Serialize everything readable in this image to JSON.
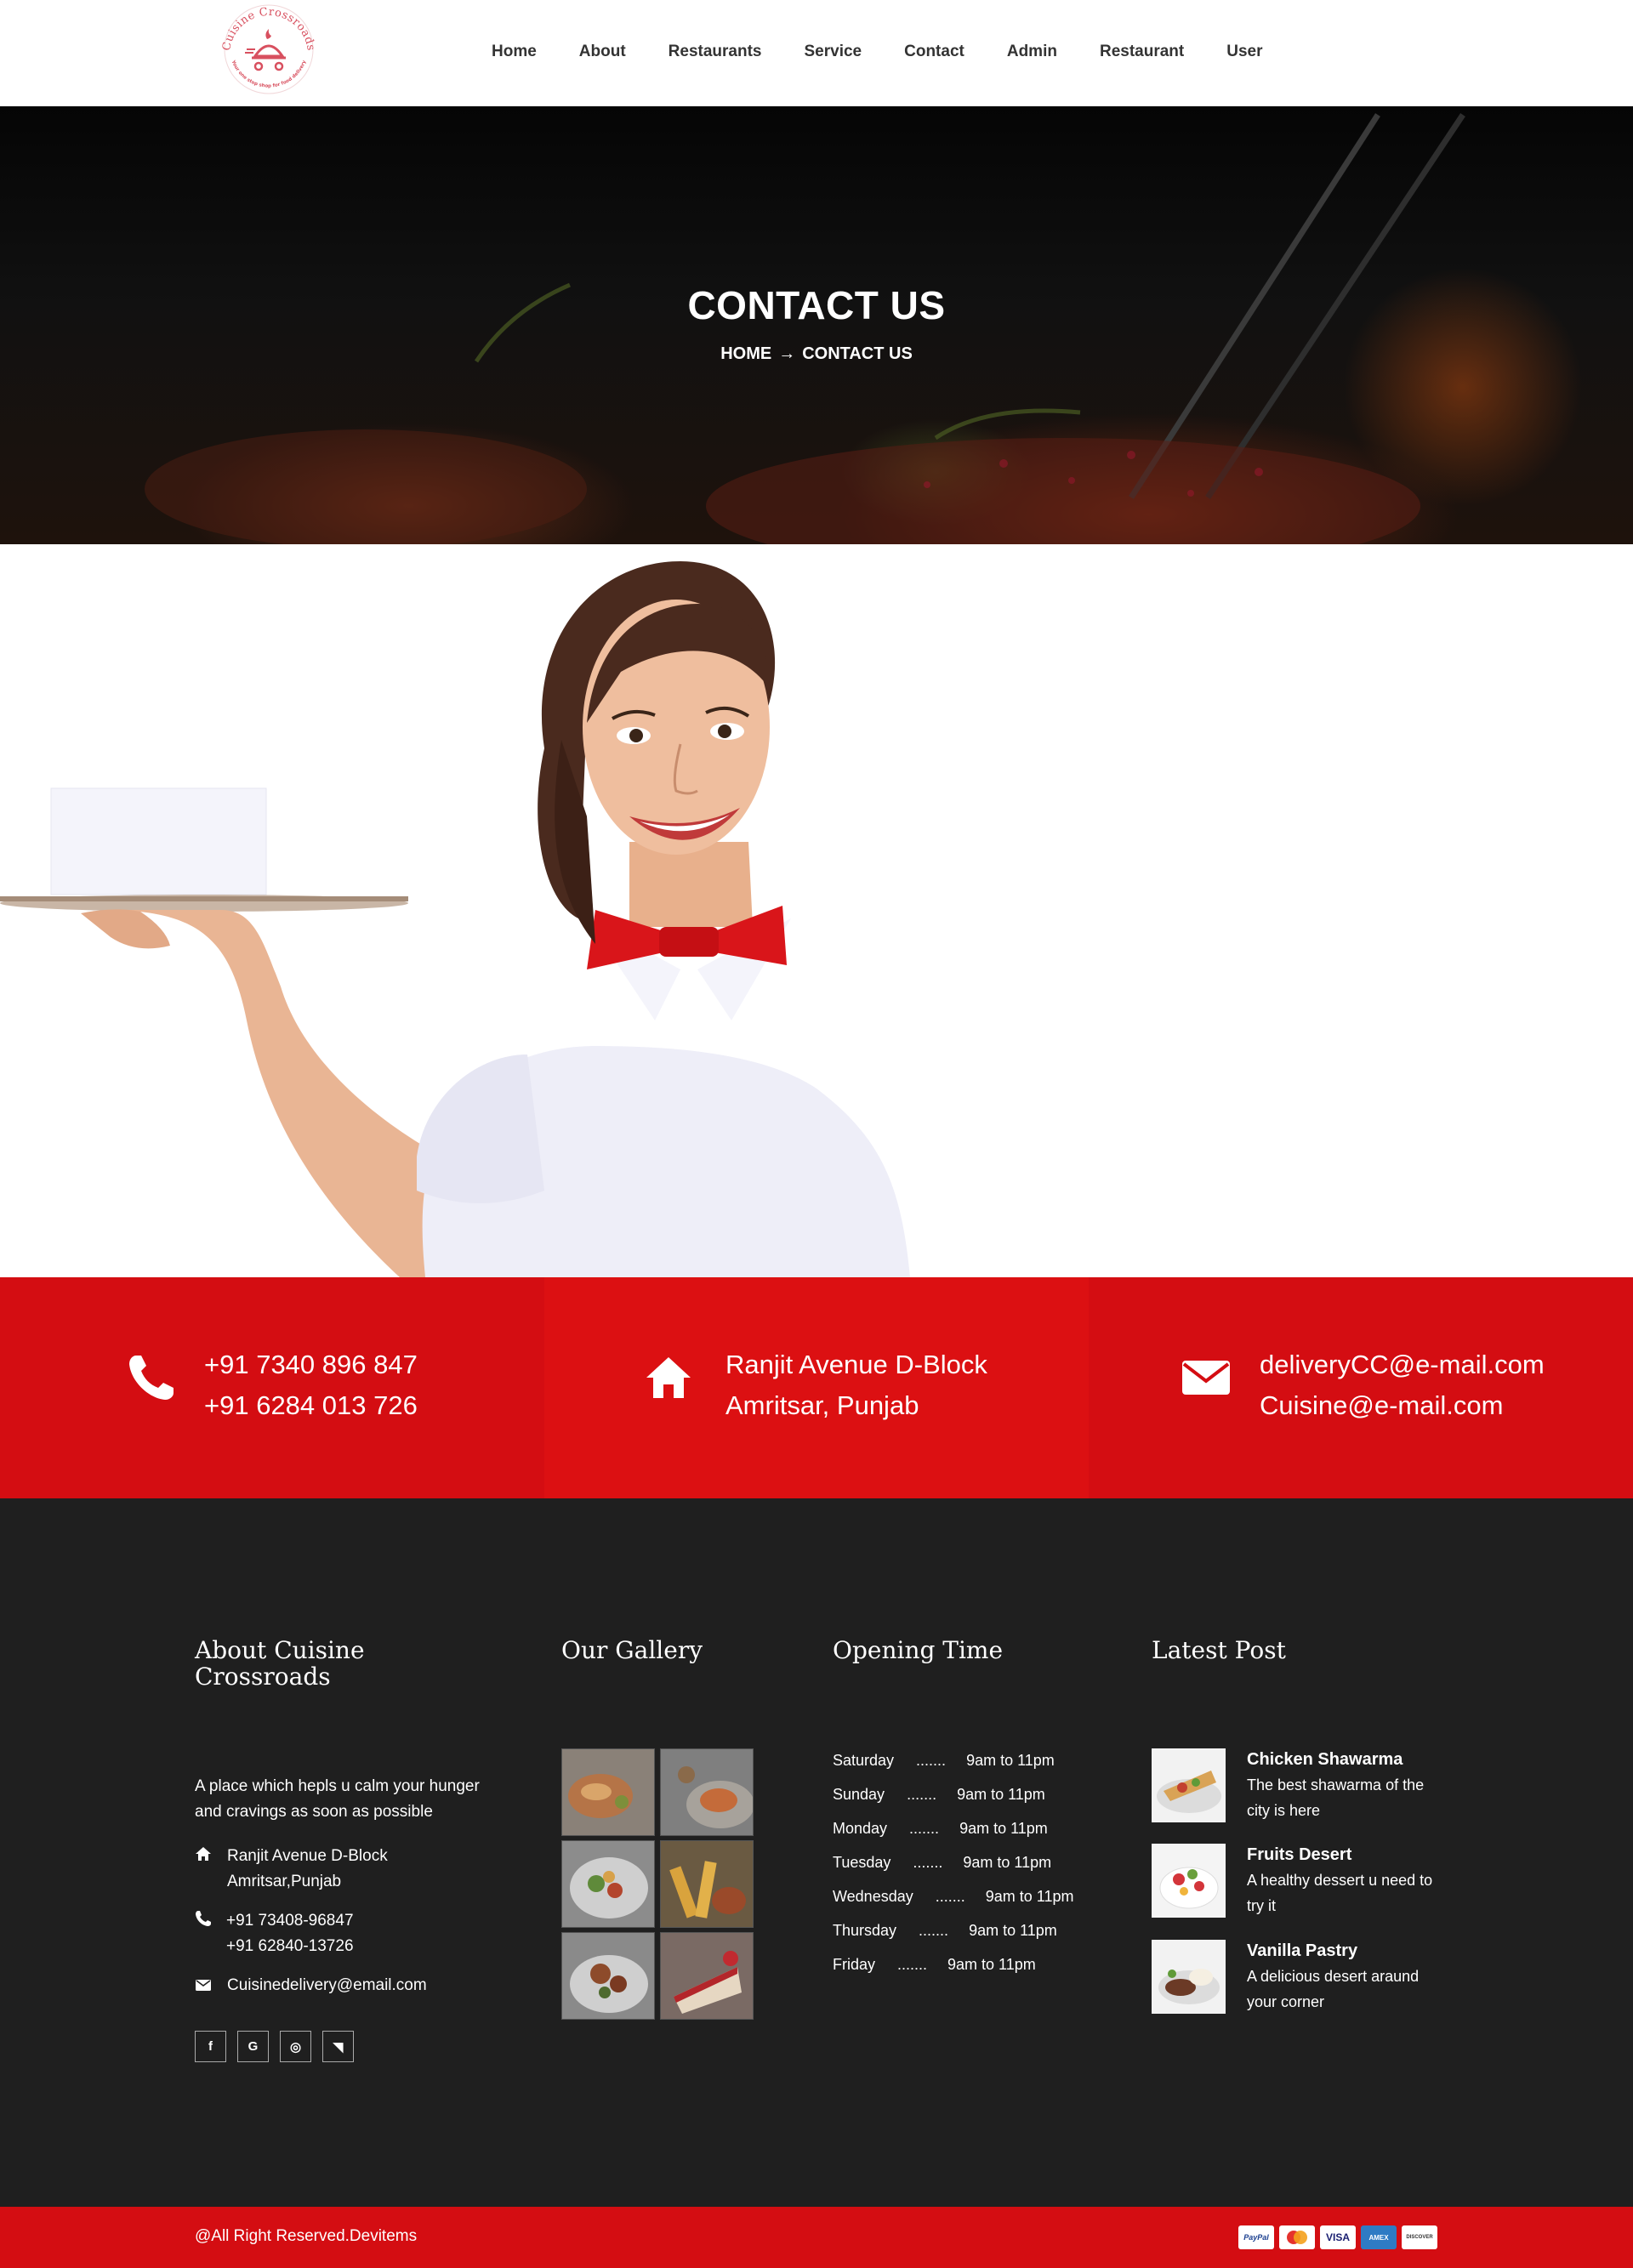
{
  "brand": {
    "logo_text": "Cuisine Crossroads",
    "logo_tagline": "Your one stop shop for food delivery",
    "accent_color": "#d40d12"
  },
  "nav": {
    "items": [
      "Home",
      "About",
      "Restaurants",
      "Service",
      "Contact",
      "Admin",
      "Restaurant",
      "User"
    ]
  },
  "hero": {
    "title": "CONTACT US",
    "breadcrumb_home": "HOME",
    "breadcrumb_arrow": "→",
    "breadcrumb_current": "CONTACT US"
  },
  "contact": {
    "phone_icon": "phone-icon",
    "phone_1": "+91 7340 896 847",
    "phone_2": "+91 6284 013 726",
    "address_icon": "home-icon",
    "address_1": "Ranjit Avenue D-Block",
    "address_2": "Amritsar, Punjab",
    "email_icon": "mail-icon",
    "email_1": "deliveryCC@e-mail.com",
    "email_2": "Cuisine@e-mail.com"
  },
  "footer": {
    "about": {
      "title_line1": "About Cuisine",
      "title_line2": "Crossroads",
      "desc_line1": "A place which hepls u calm your hunger",
      "desc_line2": "and cravings as soon as possible",
      "address_line1": "Ranjit Avenue D-Block",
      "address_line2": "Amritsar,Punjab",
      "phone_line1": "+91 73408-96847",
      "phone_line2": "+91 62840-13726",
      "email": "Cuisinedelivery@email.com",
      "social": [
        {
          "icon": "facebook-icon",
          "glyph": "f"
        },
        {
          "icon": "google-icon",
          "glyph": "G"
        },
        {
          "icon": "instagram-icon",
          "glyph": "◎"
        },
        {
          "icon": "rss-icon",
          "glyph": "◥"
        }
      ]
    },
    "gallery": {
      "title": "Our Gallery"
    },
    "hours": {
      "title": "Opening Time",
      "dots": ".......",
      "rows": [
        {
          "day": "Saturday",
          "time": "9am to 11pm"
        },
        {
          "day": "Sunday",
          "time": "9am to 11pm"
        },
        {
          "day": "Monday",
          "time": "9am to 11pm"
        },
        {
          "day": "Tuesday",
          "time": "9am to 11pm"
        },
        {
          "day": "Wednesday",
          "time": "9am to 11pm"
        },
        {
          "day": "Thursday",
          "time": "9am to 11pm"
        },
        {
          "day": "Friday",
          "time": "9am to 11pm"
        }
      ]
    },
    "posts": {
      "title": "Latest Post",
      "items": [
        {
          "title": "Chicken Shawarma",
          "desc_line1": "The best shawarma of the",
          "desc_line2": "city is here"
        },
        {
          "title": "Fruits Desert",
          "desc_line1": "A healthy dessert u need to",
          "desc_line2": "try it"
        },
        {
          "title": "Vanilla Pastry",
          "desc_line1": "A delicious desert araund",
          "desc_line2": "your corner"
        }
      ]
    }
  },
  "bottom": {
    "copyright": "@All Right Reserved.Devitems",
    "payments": [
      "PayPal",
      "MasterCard",
      "VISA",
      "AMEX",
      "DISCOVER"
    ]
  }
}
